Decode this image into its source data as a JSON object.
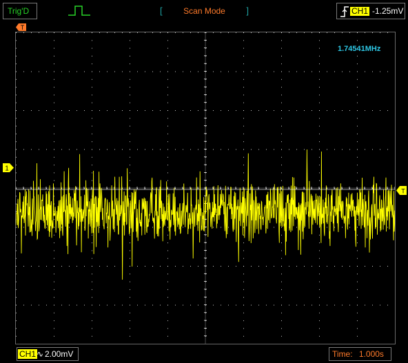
{
  "status": {
    "trigger_state": "Trig'D",
    "mode": "Scan Mode"
  },
  "trigger": {
    "channel": "CH1",
    "level": "-1.25mV",
    "edge_icon": "rising-edge-icon",
    "position_marker": "T",
    "level_marker": "T"
  },
  "channel1": {
    "label": "CH1",
    "coupling": "∿",
    "scale": "2.00mV",
    "marker": "1"
  },
  "measurement": {
    "frequency": "1.74541MHz"
  },
  "timebase": {
    "label": "Time:",
    "value": "1.000s"
  },
  "colors": {
    "trace": "#ffff00",
    "grid": "#ffffff",
    "frequency": "#2ec8e6",
    "mode": "#ff7a2a",
    "trig_status": "#28d428",
    "marker": "#ff7a2a"
  },
  "screen": {
    "h_divisions": 10,
    "v_divisions": 8
  }
}
